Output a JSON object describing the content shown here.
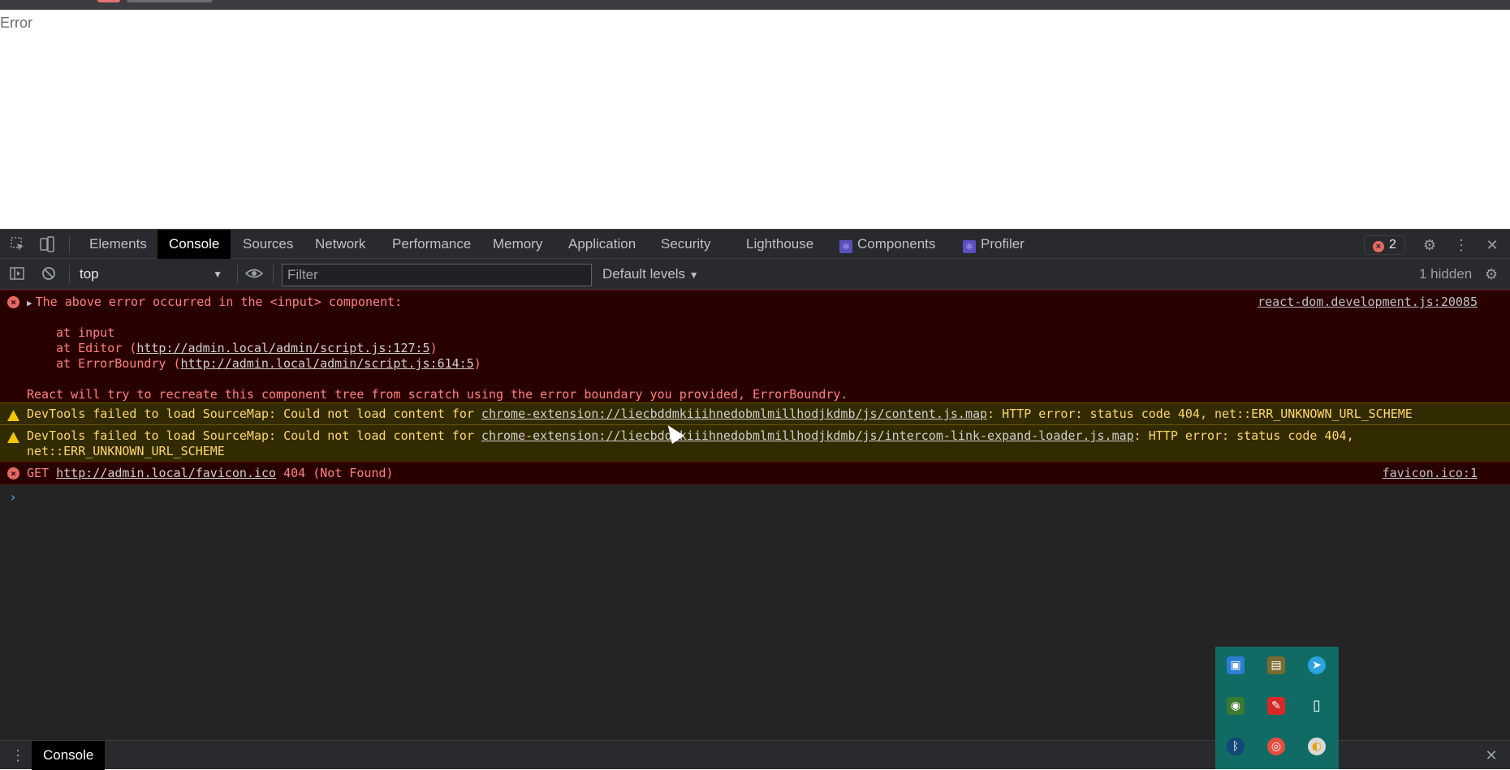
{
  "page": {
    "body_text": "Error"
  },
  "devtools": {
    "tabs": [
      "Elements",
      "Console",
      "Sources",
      "Network",
      "Performance",
      "Memory",
      "Application",
      "Security",
      "Lighthouse",
      "Components",
      "Profiler"
    ],
    "active_tab": "Console",
    "error_count": "2",
    "toolbar": {
      "context": "top",
      "filter_placeholder": "Filter",
      "levels": "Default levels",
      "hidden": "1 hidden"
    },
    "messages": {
      "m1": {
        "line1": "The above error occurred in the <input> component:",
        "source": "react-dom.development.js:20085",
        "stack_input": "at input",
        "stack_editor_pre": "at Editor (",
        "stack_editor_url": "http://admin.local/admin/script.js:127:5",
        "stack_editor_post": ")",
        "stack_eb_pre": "at ErrorBoundry (",
        "stack_eb_url": "http://admin.local/admin/script.js:614:5",
        "stack_eb_post": ")",
        "footer": "React will try to recreate this component tree from scratch using the error boundary you provided, ErrorBoundry."
      },
      "m2": {
        "pre": "DevTools failed to load SourceMap: Could not load content for ",
        "url": "chrome-extension://liecbddmkiiihnedobmlmillhodjkdmb/js/content.js.map",
        "post": ": HTTP error: status code 404, net::ERR_UNKNOWN_URL_SCHEME"
      },
      "m3": {
        "pre": "DevTools failed to load SourceMap: Could not load content for ",
        "url": "chrome-extension://liecbddmkiiihnedobmlmillhodjkdmb/js/intercom-link-expand-loader.js.map",
        "post": ": HTTP error: status code 404,",
        "line2": "net::ERR_UNKNOWN_URL_SCHEME"
      },
      "m4": {
        "pre": "GET ",
        "url": "http://admin.local/favicon.ico",
        "post": " 404 (Not Found)",
        "source": "favicon.ico:1"
      }
    },
    "prompt": "›",
    "drawer_tab": "Console"
  }
}
